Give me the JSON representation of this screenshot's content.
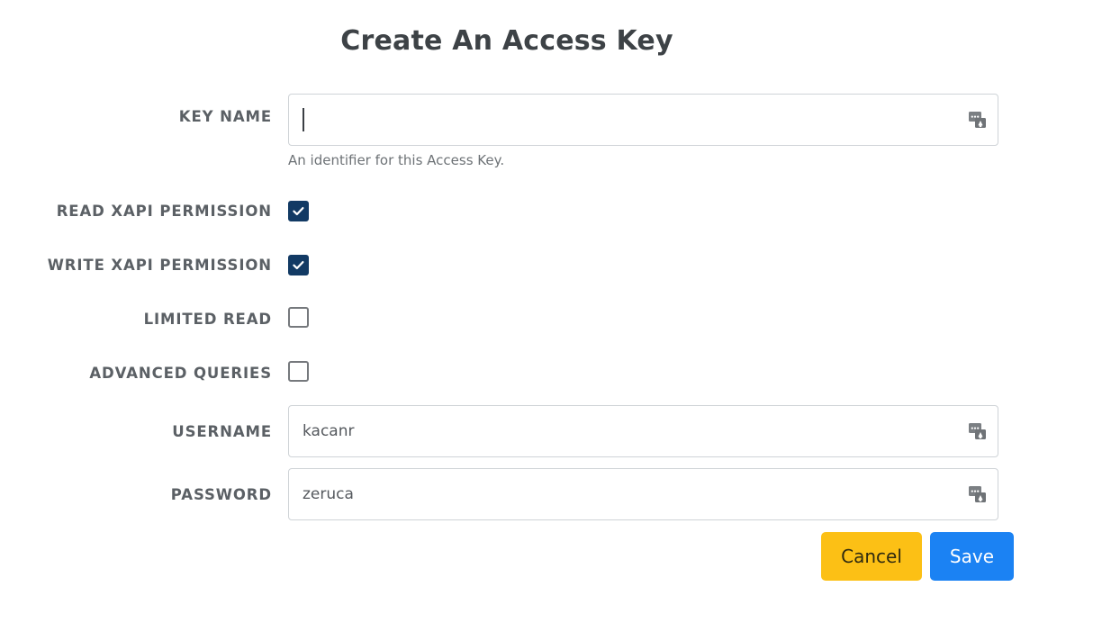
{
  "page": {
    "title": "Create An Access Key"
  },
  "form": {
    "key_name": {
      "label": "KEY NAME",
      "value": "",
      "placeholder": "",
      "help": "An identifier for this Access Key.",
      "icon": "autofill-key-icon"
    },
    "read_xapi_permission": {
      "label": "READ XAPI PERMISSION",
      "checked": true
    },
    "write_xapi_permission": {
      "label": "WRITE XAPI PERMISSION",
      "checked": true
    },
    "limited_read": {
      "label": "LIMITED READ",
      "checked": false
    },
    "advanced_queries": {
      "label": "ADVANCED QUERIES",
      "checked": false
    },
    "username": {
      "label": "USERNAME",
      "value": "kacanr",
      "placeholder": "",
      "icon": "autofill-key-icon"
    },
    "password": {
      "label": "PASSWORD",
      "value": "zeruca",
      "placeholder": "",
      "icon": "autofill-key-icon"
    }
  },
  "actions": {
    "cancel_label": "Cancel",
    "save_label": "Save"
  },
  "colors": {
    "title": "#3d4246",
    "label": "#5b6065",
    "checkbox_checked": "#123a64",
    "checkbox_border": "#76797d",
    "input_border": "#cfd3d7",
    "cancel_bg": "#fcc015",
    "save_bg": "#1b82f3",
    "help_text": "#6d7276"
  }
}
